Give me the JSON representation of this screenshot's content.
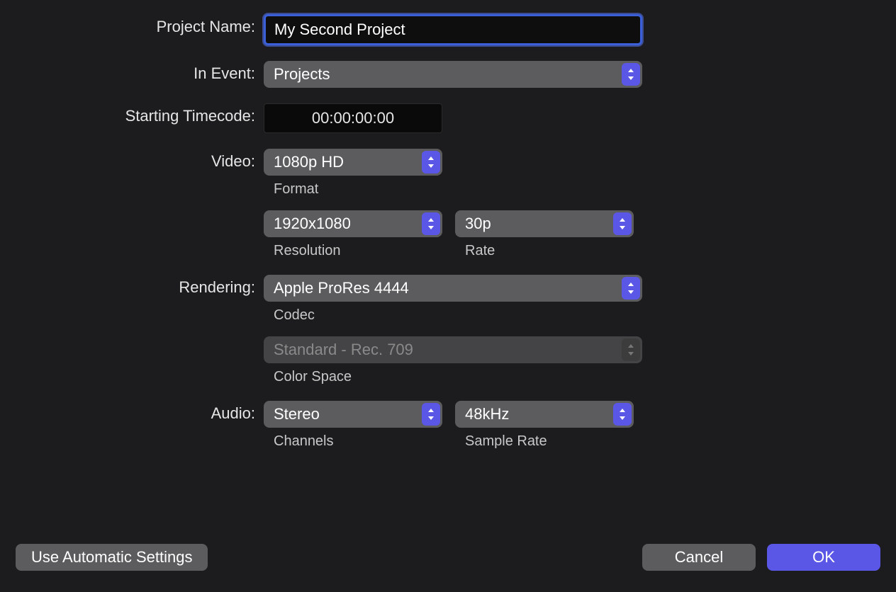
{
  "labels": {
    "projectName": "Project Name:",
    "inEvent": "In Event:",
    "startingTimecode": "Starting Timecode:",
    "video": "Video:",
    "rendering": "Rendering:",
    "audio": "Audio:"
  },
  "sublabels": {
    "format": "Format",
    "resolution": "Resolution",
    "rate": "Rate",
    "codec": "Codec",
    "colorSpace": "Color Space",
    "channels": "Channels",
    "sampleRate": "Sample Rate"
  },
  "values": {
    "projectName": "My Second Project",
    "inEvent": "Projects",
    "startingTimecode": "00:00:00:00",
    "videoFormat": "1080p HD",
    "resolution": "1920x1080",
    "rate": "30p",
    "codec": "Apple ProRes 4444",
    "colorSpace": "Standard - Rec. 709",
    "channels": "Stereo",
    "sampleRate": "48kHz"
  },
  "buttons": {
    "autoSettings": "Use Automatic Settings",
    "cancel": "Cancel",
    "ok": "OK"
  }
}
